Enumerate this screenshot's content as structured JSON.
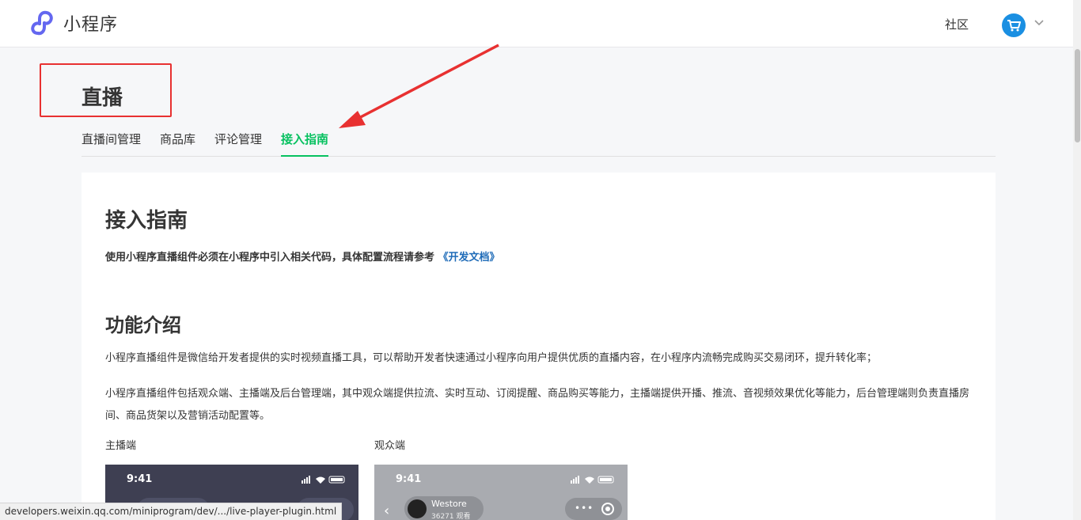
{
  "header": {
    "brand_name": "小程序",
    "community_link": "社区"
  },
  "page": {
    "title": "直播"
  },
  "tabs": [
    {
      "label": "直播间管理",
      "active": false
    },
    {
      "label": "商品库",
      "active": false
    },
    {
      "label": "评论管理",
      "active": false
    },
    {
      "label": "接入指南",
      "active": true
    }
  ],
  "content": {
    "heading": "接入指南",
    "intro_text": "使用小程序直播组件必须在小程序中引入相关代码，具体配置流程请参考",
    "intro_link": "《开发文档》",
    "section_heading": "功能介绍",
    "paragraph1": "小程序直播组件是微信给开发者提供的实时视频直播工具，可以帮助开发者快速通过小程序向用户提供优质的直播内容，在小程序内流畅完成购买交易闭环，提升转化率；",
    "paragraph2": "小程序直播组件包括观众端、主播端及后台管理端，其中观众端提供拉流、实时互动、订阅提醒、商品购买等能力，主播端提供开播、推流、音视频效果优化等能力，后台管理端则负责直播房间、商品货架以及营销活动配置等。",
    "caption_host": "主播端",
    "caption_viewer": "观众端",
    "host_phone": {
      "time": "9:41"
    },
    "viewer_phone": {
      "time": "9:41",
      "store_name": "Westore",
      "viewer_count": "36271 观看"
    }
  },
  "status_bar": {
    "url": "developers.weixin.qq.com/miniprogram/dev/.../live-player-plugin.html"
  },
  "colors": {
    "accent_green": "#07c160",
    "link_blue": "#1e6bb8",
    "annotation_red": "#e83131"
  }
}
